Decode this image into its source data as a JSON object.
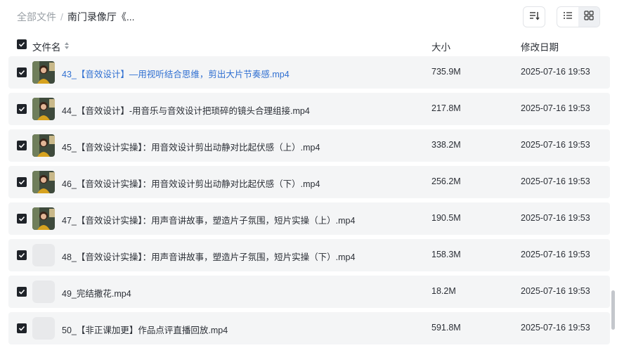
{
  "breadcrumb": {
    "root": "全部文件",
    "separator": "/",
    "current": "南门录像厅《..."
  },
  "toolbar": {
    "sort_icon": "sort-icon",
    "list_view_icon": "list-view-icon",
    "grid_view_icon": "grid-view-icon"
  },
  "table": {
    "headers": {
      "name": "文件名",
      "size": "大小",
      "modified": "修改日期"
    },
    "rows": [
      {
        "name": "43_【音效设计】—用视听结合思维，剪出大片节奏感.mp4",
        "size": "735.9M",
        "date": "2025-07-16 19:53",
        "thumb": "image",
        "highlighted": true
      },
      {
        "name": "44_【音效设计】-用音乐与音效设计把琐碎的镜头合理组接.mp4",
        "size": "217.8M",
        "date": "2025-07-16 19:53",
        "thumb": "image",
        "highlighted": false
      },
      {
        "name": "45_【音效设计实操】：用音效设计剪出动静对比起伏感（上）.mp4",
        "size": "338.2M",
        "date": "2025-07-16 19:53",
        "thumb": "image",
        "highlighted": false
      },
      {
        "name": "46_【音效设计实操】：用音效设计剪出动静对比起伏感（下）.mp4",
        "size": "256.2M",
        "date": "2025-07-16 19:53",
        "thumb": "image",
        "highlighted": false
      },
      {
        "name": "47_【音效设计实操】：用声音讲故事，塑造片子氛围，短片实操（上）.mp4",
        "size": "190.5M",
        "date": "2025-07-16 19:53",
        "thumb": "image",
        "highlighted": false
      },
      {
        "name": "48_【音效设计实操】：用声音讲故事，塑造片子氛围，短片实操（下）.mp4",
        "size": "158.3M",
        "date": "2025-07-16 19:53",
        "thumb": "empty",
        "highlighted": false
      },
      {
        "name": "49_完结撒花.mp4",
        "size": "18.2M",
        "date": "2025-07-16 19:53",
        "thumb": "empty",
        "highlighted": false
      },
      {
        "name": "50_【非正课加更】作品点评直播回放.mp4",
        "size": "591.8M",
        "date": "2025-07-16 19:53",
        "thumb": "empty",
        "highlighted": false
      }
    ]
  },
  "colors": {
    "link": "#2f6fd1",
    "row_bg": "#f4f5f6",
    "checkbox": "#1f2329"
  }
}
